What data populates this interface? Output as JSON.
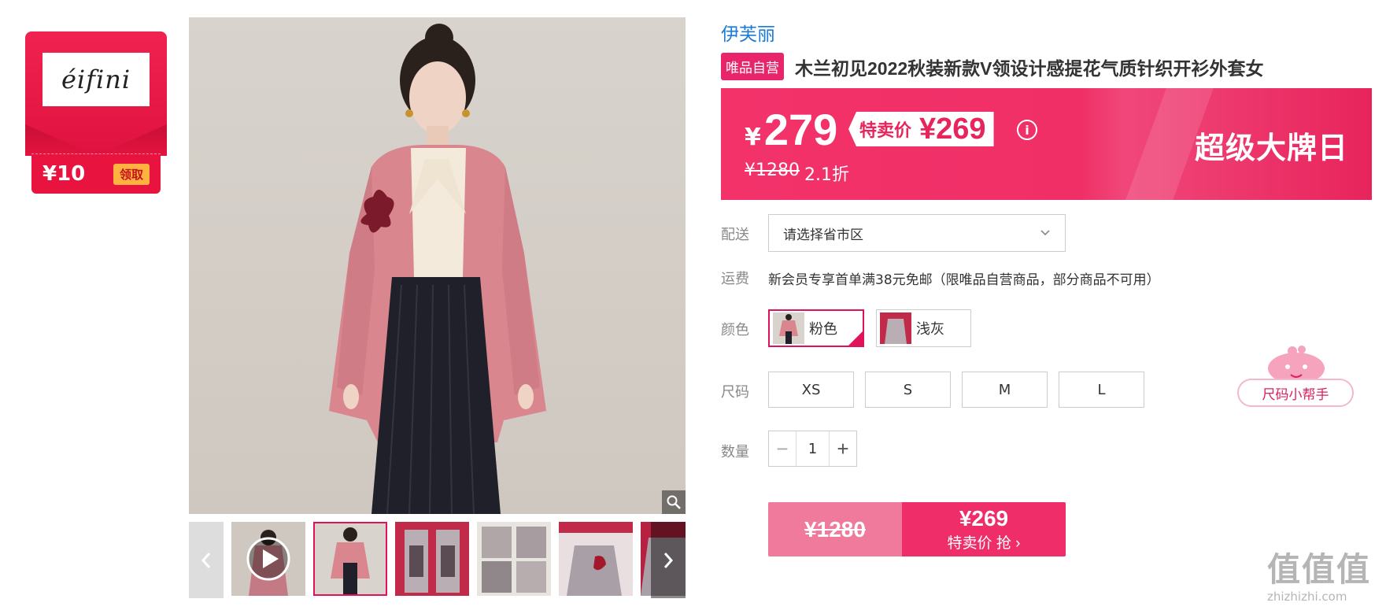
{
  "brand_card": {
    "logo_text": "éifini",
    "coupon_amount": "¥10",
    "coupon_button": "领取"
  },
  "product": {
    "brand": "伊芙丽",
    "tag": "唯品自营",
    "title": "木兰初见2022秋装新款V领设计感提花气质针织开衫外套女"
  },
  "price": {
    "yen": "¥",
    "current": "279",
    "sale_label": "特卖价",
    "sale_price": "¥269",
    "info_icon": "i",
    "original": "¥1280",
    "discount": "2.1折",
    "banner_text": "超级大牌日"
  },
  "delivery": {
    "label": "配送",
    "placeholder": "请选择省市区"
  },
  "shipping": {
    "label": "运费",
    "text": "新会员专享首单满38元免邮（限唯品自营商品，部分商品不可用）"
  },
  "color": {
    "label": "颜色",
    "options": [
      "粉色",
      "浅灰"
    ],
    "selected": "粉色"
  },
  "size": {
    "label": "尺码",
    "options": [
      "XS",
      "S",
      "M",
      "L"
    ]
  },
  "size_helper": {
    "label": "尺码小帮手"
  },
  "quantity": {
    "label": "数量",
    "value": "1",
    "minus": "−",
    "plus": "+"
  },
  "buy_button": {
    "original": "¥1280",
    "price": "¥269",
    "label": "特卖价 抢 ›"
  },
  "watermark": {
    "glyphs": "值值值",
    "url": "zhizhizhi.com"
  },
  "colors": {
    "accent": "#ee2d69",
    "brand_red": "#e8133f",
    "link_blue": "#1a7bd8"
  }
}
